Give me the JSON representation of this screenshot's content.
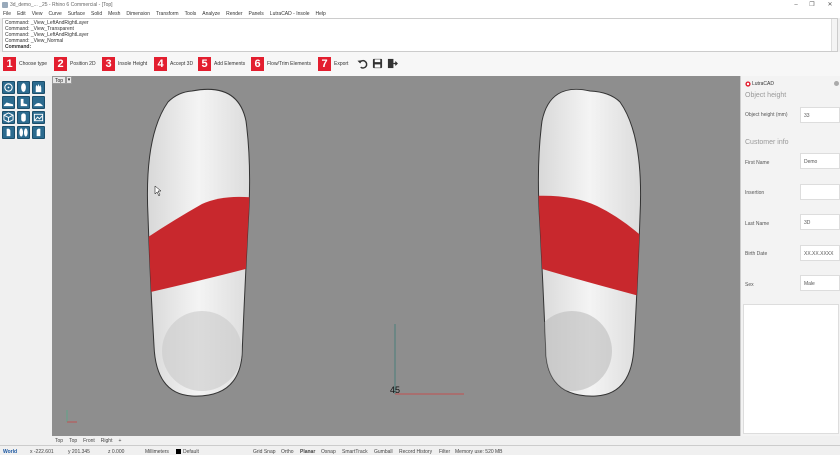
{
  "window": {
    "title": "3d_demo_... _25 - Rhino 6 Commercial - [Top]",
    "controls": [
      "–",
      "❐",
      "✕"
    ]
  },
  "menu": [
    "File",
    "Edit",
    "View",
    "Curve",
    "Surface",
    "Solid",
    "Mesh",
    "Dimension",
    "Transform",
    "Tools",
    "Analyze",
    "Render",
    "Panels",
    "LutraCAD - Insole",
    "Help"
  ],
  "command_history": [
    "Command: _View_LeftAndRightLayer",
    "Command: _View_Transparent",
    "Command: _View_LeftAndRightLayer",
    "Command: _View_Normal",
    "Command:"
  ],
  "toolbar": {
    "steps": [
      {
        "num": "1",
        "label": "Choose type"
      },
      {
        "num": "2",
        "label": "Position 2D"
      },
      {
        "num": "3",
        "label": "Insole Height"
      },
      {
        "num": "4",
        "label": "Accept 3D"
      },
      {
        "num": "5",
        "label": "Add Elements"
      },
      {
        "num": "6",
        "label": "Flow/Trim Elements"
      },
      {
        "num": "7",
        "label": "Export"
      }
    ]
  },
  "viewport": {
    "name": "Top",
    "dropdown": "▾",
    "dimension_label": "45"
  },
  "right_panel": {
    "plugin_title": "LutraCAD",
    "object_height_header": "Object height",
    "object_height_label": "Object height (mm)",
    "object_height_value": "33",
    "customer_header": "Customer info",
    "first_name_label": "First Name",
    "first_name_value": "Demo",
    "insertion_label": "Insertion",
    "insertion_value": "",
    "last_name_label": "Last Name",
    "last_name_value": "3D",
    "birth_date_label": "Birth Date",
    "birth_date_value": "XX.XX.XXXX",
    "sex_label": "Sex",
    "sex_value": "Male"
  },
  "view_tabs": [
    "Top",
    "Top",
    "Front",
    "Right",
    "+"
  ],
  "status": {
    "cplane": "World",
    "x": "x -222.601",
    "y": "y 201.345",
    "z": "z 0.000",
    "units": "Millimeters",
    "layer": "Default",
    "toggles": [
      "Grid Snap",
      "Ortho",
      "Planar",
      "Osnap",
      "SmartTrack",
      "Gumball",
      "Record History",
      "Filter"
    ],
    "memory": "Memory use: 520 MB"
  },
  "colors": {
    "accent": "#e31e2f",
    "viewport_bg": "#8e8e8e",
    "insole_red": "#c8282d",
    "tool_blue": "#2c6b8f"
  }
}
